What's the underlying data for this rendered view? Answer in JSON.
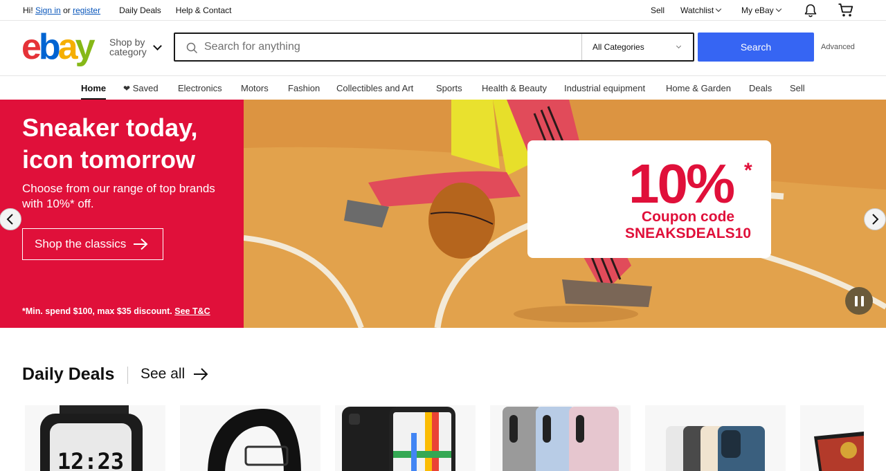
{
  "topbar": {
    "greeting": "Hi!",
    "signin": "Sign in",
    "or": "or",
    "register": "register",
    "daily_deals": "Daily Deals",
    "help": "Help & Contact",
    "sell": "Sell",
    "watchlist": "Watchlist",
    "myebay": "My eBay",
    "icons": [
      "bell-icon",
      "cart-icon"
    ]
  },
  "header": {
    "logo": {
      "e": "e",
      "b": "b",
      "a": "a",
      "y": "y"
    },
    "shop_by_line1": "Shop by",
    "shop_by_line2": "category",
    "search_placeholder": "Search for anything",
    "search_value": "",
    "category": "All Categories",
    "search_button": "Search",
    "advanced": "Advanced"
  },
  "nav": {
    "items": [
      {
        "label": "Home",
        "active": true
      },
      {
        "label": "Saved"
      },
      {
        "label": "Electronics"
      },
      {
        "label": "Motors"
      },
      {
        "label": "Fashion"
      },
      {
        "label": "Collectibles and Art"
      },
      {
        "label": "Sports"
      },
      {
        "label": "Health & Beauty"
      },
      {
        "label": "Industrial equipment"
      },
      {
        "label": "Home & Garden"
      },
      {
        "label": "Deals"
      },
      {
        "label": "Sell"
      }
    ]
  },
  "hero": {
    "title": "Sneaker today, icon tomorrow",
    "subtitle": "Choose from our range of top brands with 10%* off.",
    "cta": "Shop the classics",
    "fine_print": "*Min. spend $100, max $35 discount.",
    "fine_link": "See T&C",
    "coupon_percent": "10%",
    "coupon_star": "*",
    "coupon_line1": "Coupon code",
    "coupon_line2": "SNEAKSDEALS10",
    "colors": {
      "red": "#e0103a",
      "court": "#e7a244"
    }
  },
  "deals": {
    "title": "Daily Deals",
    "see_all": "See all",
    "items": [
      "watch",
      "belt",
      "phone",
      "phones",
      "iphones",
      "laptop"
    ]
  }
}
